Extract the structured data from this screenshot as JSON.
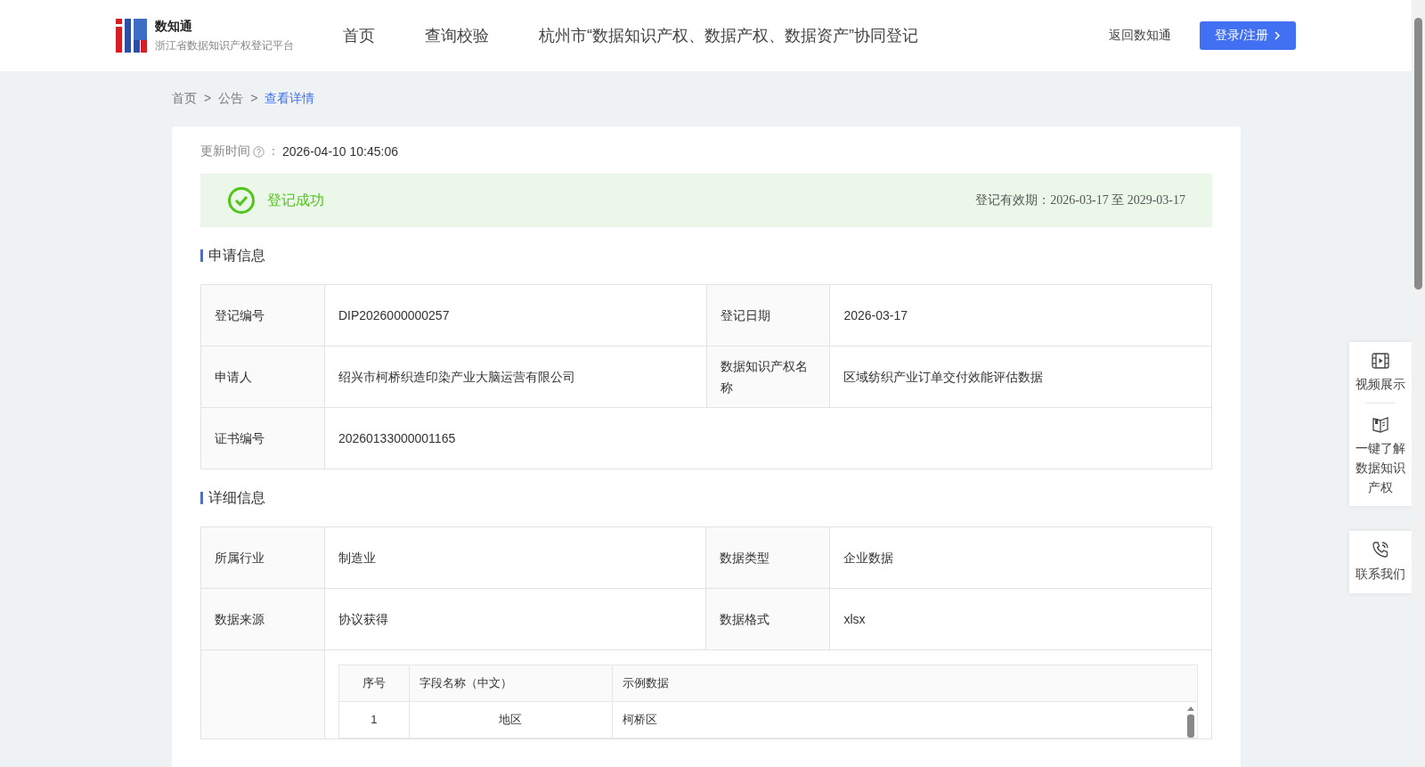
{
  "header": {
    "logo_title": "数知通",
    "logo_subtitle": "浙江省数据知识产权登记平台",
    "nav": [
      "首页",
      "查询校验",
      "杭州市“数据知识产权、数据产权、数据资产”协同登记"
    ],
    "back_link": "返回数知通",
    "login_button": "登录/注册"
  },
  "breadcrumb": [
    {
      "label": "首页",
      "selected": false
    },
    {
      "label": "公告",
      "selected": false
    },
    {
      "label": "查看详情",
      "selected": true
    }
  ],
  "breadcrumb_separator": ">",
  "update": {
    "label": "更新时间",
    "separator": "：",
    "value": "2026-04-10 10:45:06"
  },
  "status": {
    "kind": "success",
    "text": "登记成功",
    "validity": "登记有效期：2026-03-17 至 2029-03-17"
  },
  "sections": [
    {
      "title": "申请信息",
      "rows": [
        [
          {
            "label": "登记编号",
            "value": "DIP2026000000257"
          },
          {
            "label": "登记日期",
            "value": "2026-03-17"
          }
        ],
        [
          {
            "label": "申请人",
            "value": "绍兴市柯桥织造印染产业大脑运营有限公司"
          },
          {
            "label": "数据知识产权名称",
            "value": "区域纺织产业订单交付效能评估数据"
          }
        ],
        [
          {
            "label": "证书编号",
            "value": "20260133000001165"
          }
        ]
      ]
    },
    {
      "title": "详细信息",
      "rows": [
        [
          {
            "label": "所属行业",
            "value": "制造业"
          },
          {
            "label": "数据类型",
            "value": "企业数据"
          }
        ],
        [
          {
            "label": "数据来源",
            "value": "协议获得"
          },
          {
            "label": "数据格式",
            "value": "xlsx"
          }
        ]
      ],
      "field_table": {
        "columns": [
          "序号",
          "字段名称（中文）",
          "示例数据"
        ],
        "rows": [
          [
            "1",
            "地区",
            "柯桥区"
          ]
        ]
      }
    }
  ],
  "side_panel": [
    {
      "kind": "video",
      "label": "视频展示"
    },
    {
      "kind": "book",
      "label": "一键了解数据知识产权"
    }
  ],
  "contact": {
    "label": "联系我们"
  }
}
